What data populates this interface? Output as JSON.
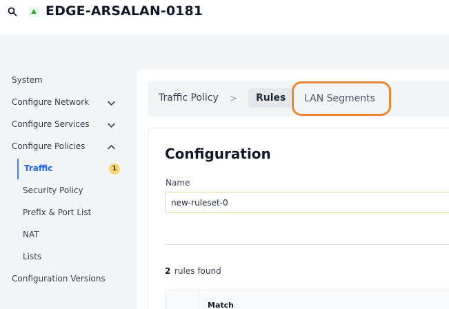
{
  "header": {
    "device_name": "EDGE-ARSALAN-0181",
    "status_color": "#35a34d"
  },
  "sidebar": {
    "items": [
      {
        "label": "System",
        "icon": null
      },
      {
        "label": "Configure Network",
        "icon": "chevron-down-icon"
      },
      {
        "label": "Configure Services",
        "icon": "chevron-down-icon"
      },
      {
        "label": "Configure Policies",
        "icon": "chevron-up-icon"
      },
      {
        "label": "Configuration Versions",
        "icon": null
      }
    ],
    "policy_items": [
      {
        "label": "Traffic",
        "active": true,
        "badge": "1"
      },
      {
        "label": "Security Policy"
      },
      {
        "label": "Prefix & Port List"
      },
      {
        "label": "NAT"
      },
      {
        "label": "Lists"
      }
    ]
  },
  "tabs": {
    "traffic_policy": "Traffic Policy",
    "separator": ">",
    "rules": "Rules",
    "lan_segments": "LAN Segments"
  },
  "config": {
    "title": "Configuration",
    "name_label": "Name",
    "name_value": "new-ruleset-0"
  },
  "rules": {
    "count": "2",
    "found_label": "rules found",
    "columns": [
      "Match"
    ]
  },
  "colors": {
    "accent": "#2563eb",
    "highlight": "#e8892f",
    "badge": "#f7d774"
  }
}
